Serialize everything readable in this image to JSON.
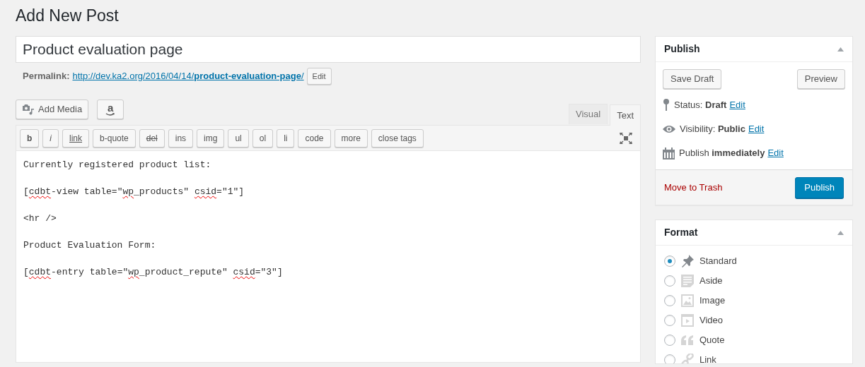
{
  "page_title": "Add New Post",
  "post_title": {
    "value": "Product evaluation page"
  },
  "permalink": {
    "label": "Permalink:",
    "url_base": "http://dev.ka2.org/2016/04/14/",
    "slug": "product-evaluation-page",
    "url_end": "/",
    "edit": "Edit"
  },
  "media_buttons": [
    {
      "kind": "media",
      "label": "Add Media"
    },
    {
      "kind": "amazon",
      "label": "a"
    }
  ],
  "editor_tabs": [
    {
      "label": "Visual",
      "selected": false
    },
    {
      "label": "Text",
      "selected": true
    }
  ],
  "quicktags": [
    {
      "label": "b",
      "kind": "bold"
    },
    {
      "label": "i",
      "kind": "italic"
    },
    {
      "label": "link",
      "kind": "underline"
    },
    {
      "label": "b-quote",
      "kind": "plain"
    },
    {
      "label": "del",
      "kind": "strike"
    },
    {
      "label": "ins",
      "kind": "plain"
    },
    {
      "label": "img",
      "kind": "plain"
    },
    {
      "label": "ul",
      "kind": "plain"
    },
    {
      "label": "ol",
      "kind": "plain"
    },
    {
      "label": "li",
      "kind": "plain"
    },
    {
      "label": "code",
      "kind": "plain"
    },
    {
      "label": "more",
      "kind": "plain"
    },
    {
      "label": "close tags",
      "kind": "plain"
    }
  ],
  "editor_lines": [
    [
      {
        "text": "Currently registered product list:",
        "misspelled": false
      }
    ],
    [
      {
        "text": "[",
        "misspelled": false
      },
      {
        "text": "cdbt",
        "misspelled": true
      },
      {
        "text": "-view table=\"",
        "misspelled": false
      },
      {
        "text": "wp",
        "misspelled": true
      },
      {
        "text": "_products\" ",
        "misspelled": false
      },
      {
        "text": "csid",
        "misspelled": true
      },
      {
        "text": "=\"1\"]",
        "misspelled": false
      }
    ],
    [
      {
        "text": "<hr />",
        "misspelled": false
      }
    ],
    [
      {
        "text": "Product Evaluation Form:",
        "misspelled": false
      }
    ],
    [
      {
        "text": "[",
        "misspelled": false
      },
      {
        "text": "cdbt",
        "misspelled": true
      },
      {
        "text": "-entry table=\"",
        "misspelled": false
      },
      {
        "text": "wp",
        "misspelled": true
      },
      {
        "text": "_product_repute\" ",
        "misspelled": false
      },
      {
        "text": "csid",
        "misspelled": true
      },
      {
        "text": "=\"3\"]",
        "misspelled": false
      }
    ]
  ],
  "publish_box": {
    "title": "Publish",
    "save_draft": "Save Draft",
    "preview": "Preview",
    "rows": [
      {
        "kind": "pin",
        "text": "Status: **Draft**",
        "edit": "Edit"
      },
      {
        "kind": "eye",
        "text": "Visibility: **Public**",
        "edit": "Edit"
      },
      {
        "kind": "calendar",
        "text": "Publish **immediately**",
        "edit": "Edit"
      }
    ],
    "trash": "Move to Trash",
    "publish": "Publish"
  },
  "format_box": {
    "title": "Format",
    "options": [
      {
        "kind": "pin",
        "label": "Standard",
        "selected": true
      },
      {
        "kind": "aside",
        "label": "Aside",
        "selected": false
      },
      {
        "kind": "image",
        "label": "Image",
        "selected": false
      },
      {
        "kind": "video",
        "label": "Video",
        "selected": false
      },
      {
        "kind": "quote",
        "label": "Quote",
        "selected": false
      },
      {
        "kind": "link",
        "label": "Link",
        "selected": false
      }
    ]
  }
}
